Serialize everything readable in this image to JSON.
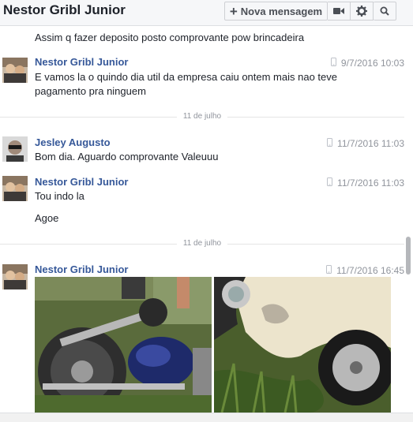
{
  "header": {
    "title": "Nestor Gribl Junior",
    "new_message_label": "Nova mensagem",
    "icons": [
      "video-icon",
      "gear-icon",
      "search-icon"
    ]
  },
  "thread": {
    "top_partial_text": "Assim q fazer deposito posto comprovante  pow brincadeira",
    "messages": [
      {
        "sender": "Nestor Gribl Junior",
        "time": "9/7/2016 10:03",
        "lines": [
          "E vamos la o quindo dia util da empresa caiu  ontem mais nao teve",
          "pagamento pra ninguem"
        ]
      },
      {
        "sender": "Jesley Augusto",
        "time": "11/7/2016 11:03",
        "lines": [
          "Bom dia. Aguardo comprovante Valeuuu"
        ]
      },
      {
        "sender": "Nestor Gribl Junior",
        "time": "11/7/2016 11:03",
        "lines": [
          "Tou indo la",
          "Agoe"
        ]
      },
      {
        "sender": "Nestor Gribl Junior",
        "time": "11/7/2016 16:45",
        "photos": [
          "motorcycle-wreck-photo",
          "car-damage-photo"
        ]
      }
    ],
    "separators": [
      "11 de julho",
      "11 de julho"
    ]
  },
  "colors": {
    "sender": "#365899",
    "text": "#1d2129",
    "meta": "#90949c",
    "header_bg": "#f6f7f9"
  }
}
